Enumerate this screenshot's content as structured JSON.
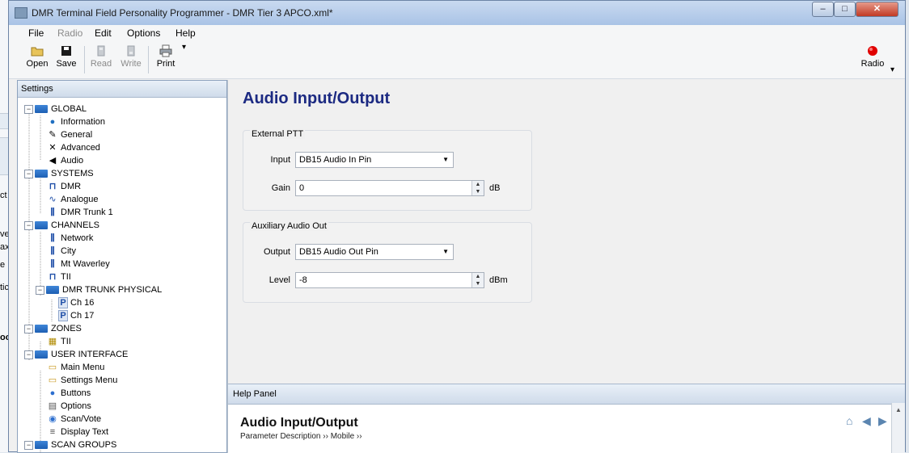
{
  "window": {
    "title": "DMR Terminal Field Personality Programmer - DMR Tier 3 APCO.xml*",
    "minimize": "–",
    "maximize": "□",
    "close": "✕"
  },
  "background_fragments": [
    "ct",
    "ve",
    "ax",
    "e",
    "tic",
    "oo"
  ],
  "menu": [
    "File",
    "Radio",
    "Edit",
    "Options",
    "Help"
  ],
  "toolbar": {
    "open": "Open",
    "save": "Save",
    "read": "Read",
    "write": "Write",
    "print": "Print",
    "print_more": "▾",
    "radio": "Radio",
    "radio_more": "▾"
  },
  "settings": {
    "header": "Settings",
    "tree": [
      "GLOBAL",
      "Information",
      "General",
      "Advanced",
      "Audio",
      "SYSTEMS",
      "DMR",
      "Analogue",
      "DMR Trunk 1",
      "CHANNELS",
      "Network",
      "City",
      "Mt Waverley",
      "TII",
      "DMR TRUNK PHYSICAL",
      "Ch 16",
      "Ch 17",
      "ZONES",
      "TII",
      "USER INTERFACE",
      "Main Menu",
      "Settings Menu",
      "Buttons",
      "Options",
      "Scan/Vote",
      "Display Text",
      "SCAN GROUPS"
    ]
  },
  "content": {
    "title": "Audio Input/Output",
    "external_ptt": {
      "group_title": "External PTT",
      "input_label": "Input",
      "input_value": "DB15 Audio In Pin",
      "gain_label": "Gain",
      "gain_value": "0",
      "gain_unit": "dB"
    },
    "aux_audio": {
      "group_title": "Auxiliary Audio Out",
      "output_label": "Output",
      "output_value": "DB15 Audio Out Pin",
      "level_label": "Level",
      "level_value": "-8",
      "level_unit": "dBm"
    }
  },
  "help": {
    "header": "Help Panel",
    "title": "Audio Input/Output",
    "breadcrumb": "Parameter Description ›› Mobile ››"
  },
  "colors": {
    "title_blue": "#1c2a82",
    "folder_blue": "#1d5fb3",
    "radio_red": "#e00000"
  }
}
